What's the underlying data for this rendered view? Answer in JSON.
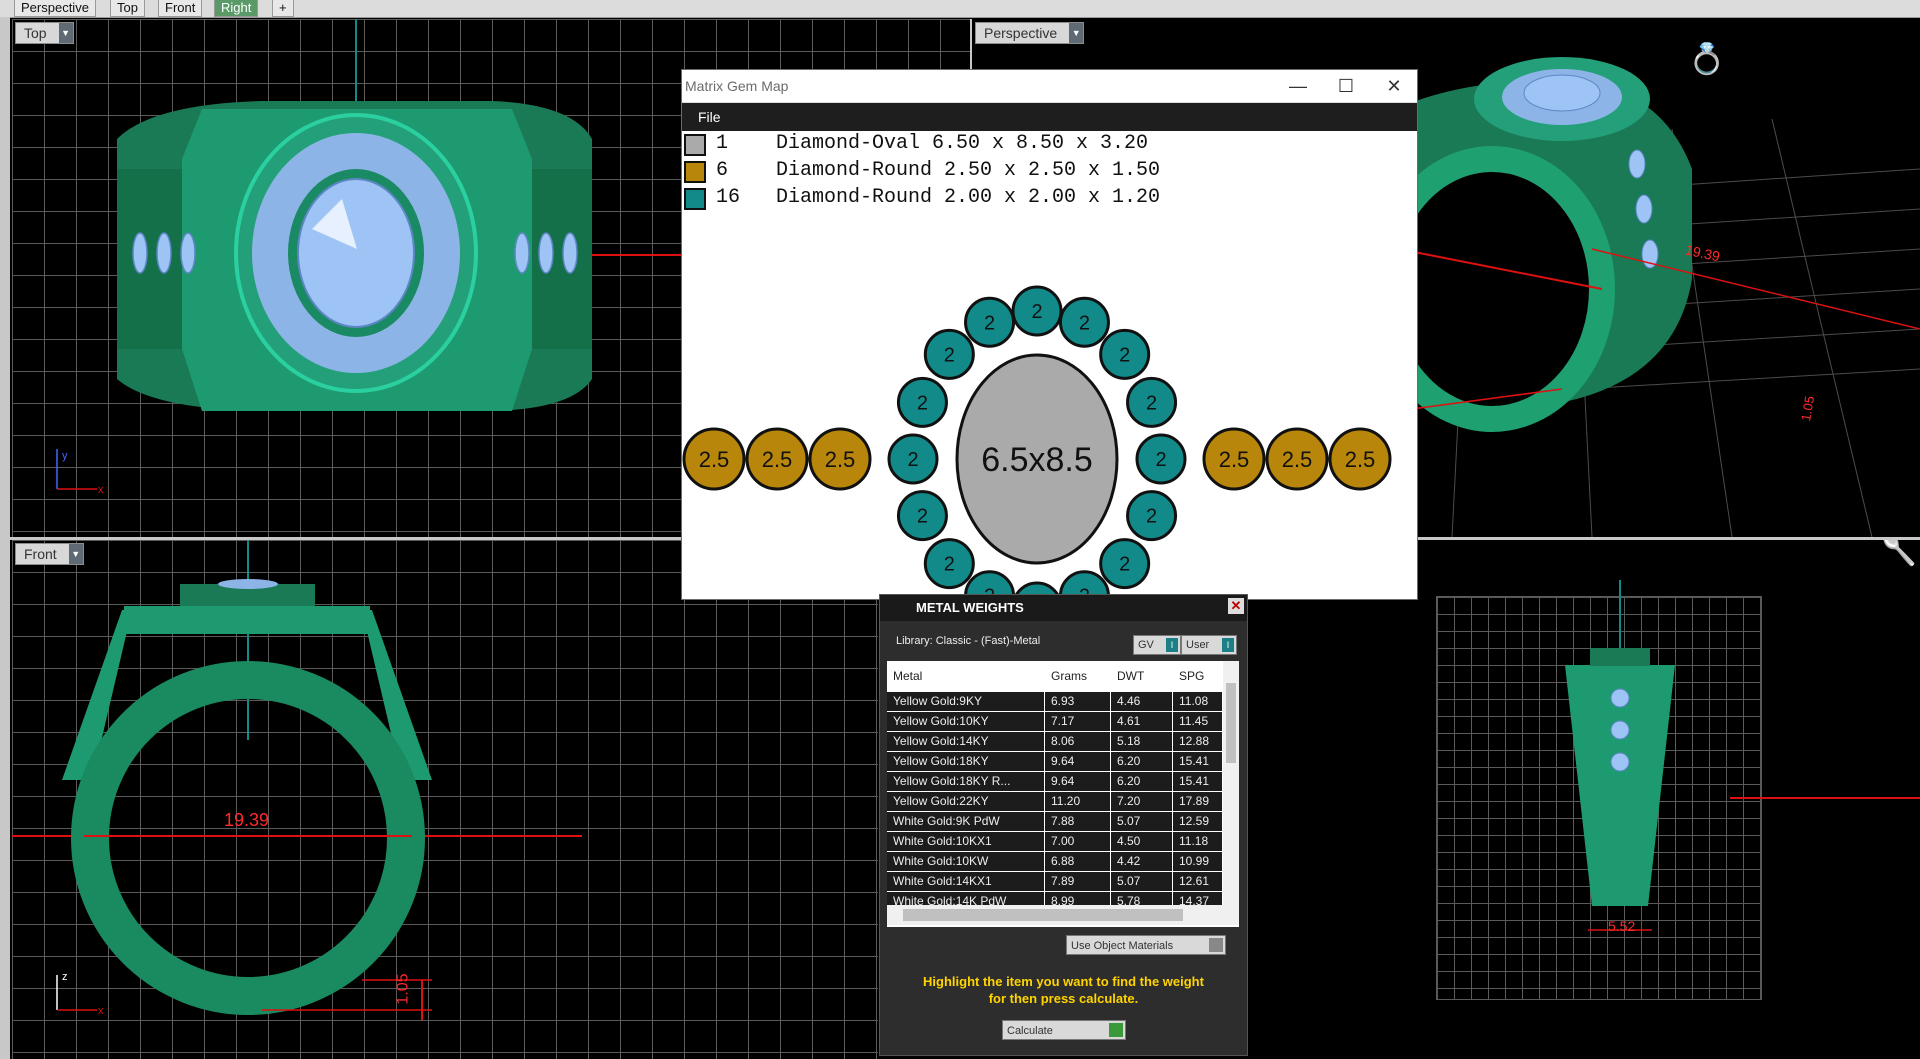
{
  "tabs": [
    "Perspective",
    "Top",
    "Front",
    "Right",
    "+"
  ],
  "viewports": {
    "top_left": {
      "label": "Top"
    },
    "top_right": {
      "label": "Perspective"
    },
    "bottom_left": {
      "label": "Front"
    }
  },
  "dimensions": {
    "front_inner_diameter": "19.39",
    "front_thickness": "1.05",
    "persp_diameter": "19.39",
    "persp_small": "1.05",
    "right_width": "5.52"
  },
  "gem_map": {
    "title": "Matrix Gem Map",
    "menu_file": "File",
    "controls": {
      "minimize": "—",
      "maximize": "☐",
      "close": "✕"
    },
    "legend": [
      {
        "count": "1",
        "description": "Diamond-Oval 6.50 x 8.50 x 3.20",
        "color": "#aaaaaa"
      },
      {
        "count": "6",
        "description": "Diamond-Round 2.50 x 2.50 x 1.50",
        "color": "#b8860b"
      },
      {
        "count": "16",
        "description": "Diamond-Round 2.00 x 2.00 x 1.20",
        "color": "#138a8a"
      }
    ],
    "center_label": "6.5x8.5",
    "halo_label": "2",
    "side_label": "2.5"
  },
  "metal_weights": {
    "title": "METAL WEIGHTS",
    "library": "Library: Classic - (Fast)-Metal",
    "gv_label": "GV",
    "user_label": "User",
    "columns": [
      "Metal",
      "Grams",
      "DWT",
      "SPG"
    ],
    "rows": [
      [
        "Yellow Gold:9KY",
        "6.93",
        "4.46",
        "11.08"
      ],
      [
        "Yellow Gold:10KY",
        "7.17",
        "4.61",
        "11.45"
      ],
      [
        "Yellow Gold:14KY",
        "8.06",
        "5.18",
        "12.88"
      ],
      [
        "Yellow Gold:18KY",
        "9.64",
        "6.20",
        "15.41"
      ],
      [
        "Yellow Gold:18KY R...",
        "9.64",
        "6.20",
        "15.41"
      ],
      [
        "Yellow Gold:22KY",
        "11.20",
        "7.20",
        "17.89"
      ],
      [
        "White Gold:9K PdW",
        "7.88",
        "5.07",
        "12.59"
      ],
      [
        "White Gold:10KX1",
        "7.00",
        "4.50",
        "11.18"
      ],
      [
        "White Gold:10KW",
        "6.88",
        "4.42",
        "10.99"
      ],
      [
        "White Gold:14KX1",
        "7.89",
        "5.07",
        "12.61"
      ],
      [
        "White Gold:14K PdW",
        "8.99",
        "5.78",
        "14.37"
      ]
    ],
    "use_object_materials": "Use Object Materials",
    "hint_line1": "Highlight the item you want to find the weight",
    "hint_line2": "for then press calculate.",
    "calculate": "Calculate"
  }
}
